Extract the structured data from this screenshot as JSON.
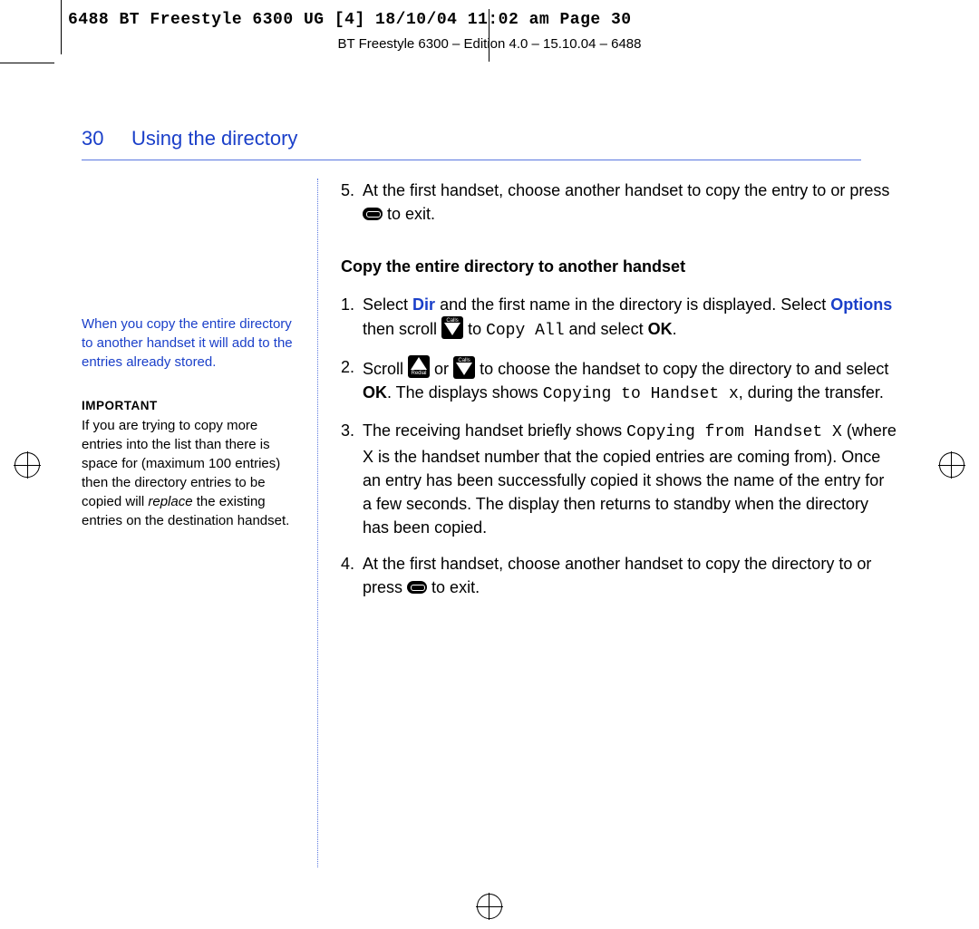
{
  "meta": {
    "slug": "6488 BT Freestyle 6300 UG [4]  18/10/04  11:02 am  Page 30",
    "edition": "BT Freestyle 6300 – Edition 4.0 – 15.10.04 – 6488"
  },
  "header": {
    "page_number": "30",
    "title": "Using the directory"
  },
  "sidebar": {
    "note1": "When you copy the entire directory to another handset it will add to the entries already stored.",
    "important_label": "IMPORTANT",
    "important_pre": "If you are trying to copy more entries into the list than there is space for (maximum 100 entries) then the directory entries to be copied will ",
    "important_em": "replace",
    "important_post": " the existing entries on the destination handset."
  },
  "main": {
    "prev_step": {
      "num": "5.",
      "t1": "At the first handset, choose another handset to copy the entry to or press ",
      "t2": " to exit."
    },
    "heading": "Copy the entire directory to another handset",
    "steps": [
      {
        "num": "1.",
        "t1": "Select ",
        "dir": "Dir",
        "t2": " and the first name in the directory is displayed. Select ",
        "options": "Options",
        "t3": " then scroll ",
        "t4": " to ",
        "lcd1": "Copy All",
        "t5": " and select ",
        "ok": "OK",
        "t6": "."
      },
      {
        "num": "2.",
        "t1": "Scroll ",
        "t2": " or ",
        "t3": " to choose the handset to copy the directory to and select ",
        "ok": "OK",
        "t4": ". The displays shows ",
        "lcd1": "Copying to Handset x",
        "t5": ", during the transfer."
      },
      {
        "num": "3.",
        "t1": "The receiving handset briefly shows ",
        "lcd1": "Copying from Handset X",
        "t2": " (where X is the handset number that the copied entries are coming from). Once an entry has been successfully copied it shows the name of the entry for a few seconds. The display then returns to standby when the directory has been copied."
      },
      {
        "num": "4.",
        "t1": "At the first handset, choose another handset to copy the directory to or press ",
        "t2": " to exit."
      }
    ]
  }
}
